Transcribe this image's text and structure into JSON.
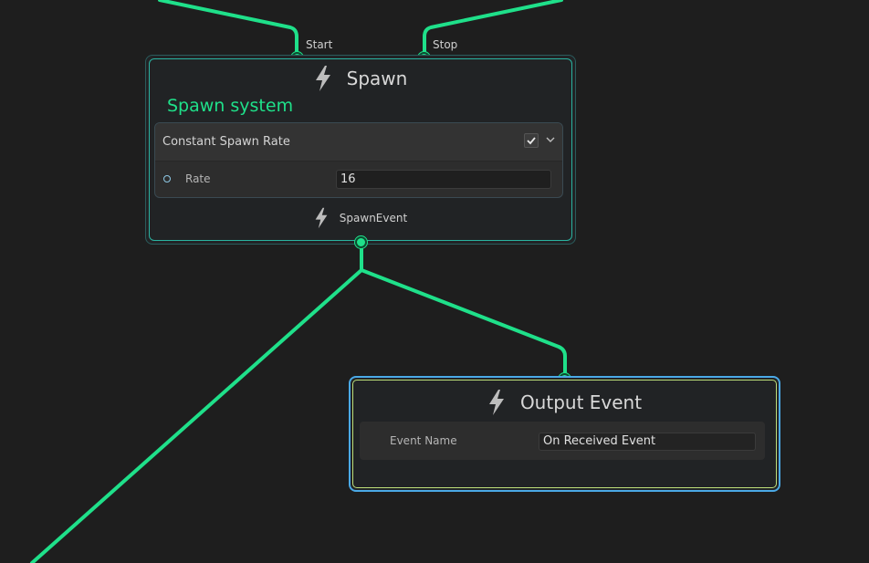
{
  "colors": {
    "wire": "#1fe08a",
    "background": "#1e1e1e",
    "spawn_border": "#2ab3a0",
    "output_border": "#4aa9e6"
  },
  "spawn_node": {
    "input_ports": [
      {
        "label": "Start"
      },
      {
        "label": "Stop"
      }
    ],
    "icon": "lightning-bolt-icon",
    "title": "Spawn",
    "system_title": "Spawn system",
    "block": {
      "title": "Constant Spawn Rate",
      "enabled": true,
      "rows": [
        {
          "label": "Rate",
          "value": "16"
        }
      ]
    },
    "output_port": {
      "label": "SpawnEvent",
      "icon": "lightning-bolt-icon"
    }
  },
  "output_event_node": {
    "icon": "lightning-bolt-icon",
    "title": "Output Event",
    "fields": [
      {
        "label": "Event Name",
        "value": "On Received Event"
      }
    ]
  }
}
